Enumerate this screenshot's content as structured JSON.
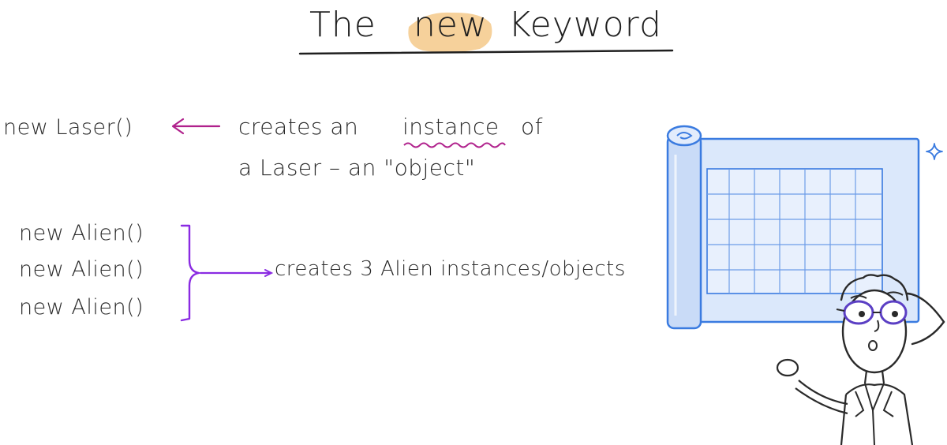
{
  "title": {
    "part1": "The",
    "highlight": "new",
    "part2": "Keyword"
  },
  "example_laser": {
    "code": "new Laser()",
    "note_line1_a": "creates an",
    "note_line1_emphasis": "instance",
    "note_line1_b": "of",
    "note_line2": "a Laser – an \"object\""
  },
  "example_aliens": {
    "code_lines": [
      "new Alien()",
      "new Alien()",
      "new Alien()"
    ],
    "note": "creates 3 Alien instances/objects"
  },
  "colors": {
    "highlight": "#f5c98a",
    "arrow_magenta": "#b0218c",
    "brace_purple": "#8a2be2",
    "blueprint_fill": "#dbe8fb",
    "blueprint_stroke": "#3a7be0",
    "glasses_purple": "#5b3fc4"
  },
  "icons": {
    "blueprint": "blueprint-scroll-icon",
    "sparkle": "sparkle-icon",
    "character": "scientist-character-icon"
  }
}
